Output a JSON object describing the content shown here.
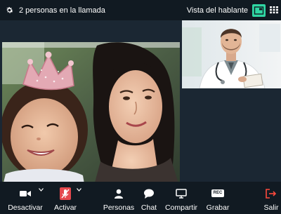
{
  "topbar": {
    "participants_text": "2 personas en la llamada",
    "view_label": "Vista del hablante",
    "icons": {
      "settings": "gear-icon",
      "speaker_view": "speaker-view-icon",
      "grid_view": "grid-view-icon"
    },
    "accent_color": "#2fd6a3"
  },
  "toolbar": {
    "video_label": "Desactivar",
    "mic_label": "Activar",
    "people_label": "Personas",
    "chat_label": "Chat",
    "share_label": "Compartir",
    "record_label": "Grabar",
    "record_badge": "REC",
    "leave_label": "Salir",
    "mic_muted_color": "#e5484d",
    "leave_color": "#ff4a3d"
  }
}
